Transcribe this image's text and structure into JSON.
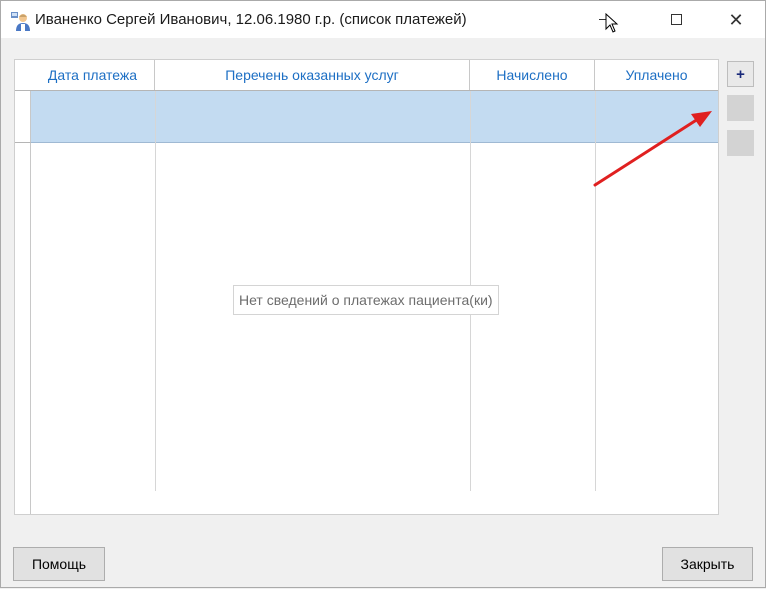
{
  "window": {
    "title": "Иваненко Сергей Иванович, 12.06.1980 г.р. (список платежей)"
  },
  "grid": {
    "columns": [
      {
        "label": "Дата платежа"
      },
      {
        "label": "Перечень оказанных услуг"
      },
      {
        "label": "Начислено"
      },
      {
        "label": "Уплачено"
      }
    ],
    "empty_message": "Нет сведений о платежах пациента(ки)"
  },
  "side_buttons": {
    "add_label": "+"
  },
  "footer": {
    "help_label": "Помощь",
    "close_label": "Закрыть"
  },
  "colors": {
    "header_text": "#1d6fc4",
    "selected_row": "#c3dbf1",
    "annotation_arrow": "#e02020"
  }
}
